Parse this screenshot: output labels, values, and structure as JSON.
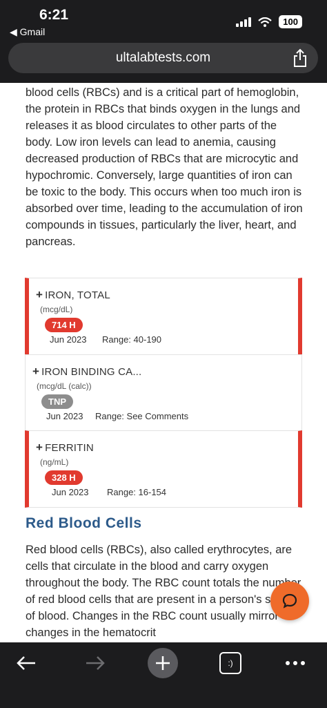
{
  "status": {
    "time": "6:21",
    "back_app": "◀ Gmail",
    "battery": "100"
  },
  "browser": {
    "url": "ultalabtests.com"
  },
  "article": {
    "intro_paragraph": "blood cells (RBCs) and is a critical part of hemoglobin, the protein in RBCs that binds oxygen in the lungs and releases it as blood circulates to other parts of the body. Low iron levels can lead to anemia, causing decreased production of RBCs that are microcytic and hypochromic. Conversely, large quantities of iron can be toxic to the body. This occurs when too much iron is absorbed over time, leading to the accumulation of iron compounds in tissues, particularly the liver, heart, and pancreas.",
    "section_heading": "Red Blood Cells",
    "section_paragraph": "Red blood cells (RBCs), also called erythrocytes, are cells that circulate in the blood and carry oxygen throughout the body. The RBC count totals the number of red blood cells that are present in a person's sample of blood. Changes in the RBC count usually mirror changes in the hematocrit"
  },
  "results": [
    {
      "plus": "+",
      "name": "IRON, TOTAL",
      "unit": "(mcg/dL)",
      "value": "714 H",
      "date": "Jun 2023",
      "range": "Range: 40-190",
      "flag": "high"
    },
    {
      "plus": "+",
      "name": "IRON BINDING CA...",
      "unit": "(mcg/dL (calc))",
      "value": "TNP",
      "date": "Jun 2023",
      "range": "Range: See Comments",
      "flag": "normal"
    },
    {
      "plus": "+",
      "name": "FERRITIN",
      "unit": "(ng/mL)",
      "value": "328 H",
      "date": "Jun 2023",
      "range": "Range: 16-154",
      "flag": "high"
    }
  ],
  "toolbar": {
    "tabs_label": ":)"
  },
  "colors": {
    "high_flag": "#e13a2f",
    "heading": "#2c5a8a",
    "chat_button": "#ef6b2a"
  },
  "icons": [
    "signal-icon",
    "wifi-icon",
    "share-icon",
    "chat-icon",
    "back-arrow-icon",
    "forward-arrow-icon",
    "plus-icon",
    "more-icon"
  ]
}
